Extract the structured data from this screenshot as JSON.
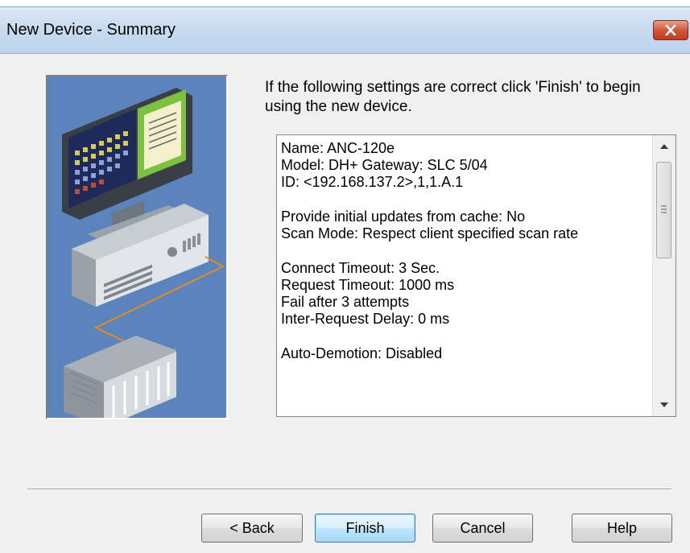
{
  "window": {
    "title": "New Device - Summary",
    "close_icon": "close-icon"
  },
  "instruction": "If the following settings are correct click 'Finish' to begin using the new device.",
  "summary": {
    "lines": [
      "Name: ANC-120e",
      "Model: DH+ Gateway: SLC 5/04",
      "ID: <192.168.137.2>,1,1.A.1",
      "",
      "Provide initial updates from cache: No",
      "Scan Mode: Respect client specified scan rate",
      "",
      "Connect Timeout: 3 Sec.",
      "Request Timeout: 1000 ms",
      "Fail after 3 attempts",
      "Inter-Request Delay: 0 ms",
      "",
      "Auto-Demotion: Disabled"
    ]
  },
  "buttons": {
    "back": "< Back",
    "finish": "Finish",
    "cancel": "Cancel",
    "help": "Help"
  },
  "colors": {
    "illustration_bg": "#5b84bd",
    "close_button": "#c8482d",
    "default_button_border": "#3c7fb1"
  }
}
